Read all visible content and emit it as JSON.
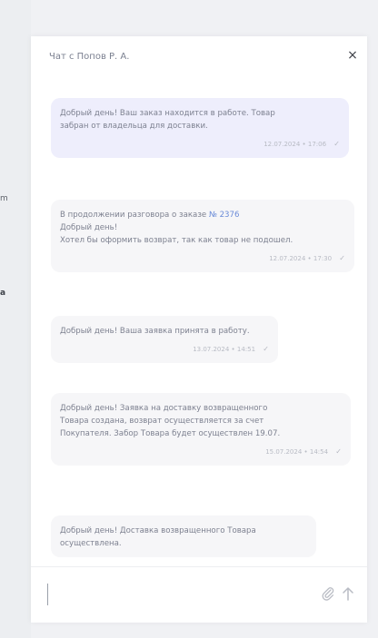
{
  "background": {
    "fragments": [
      "m",
      "а"
    ]
  },
  "chat": {
    "title": "Чат с Попов Р. А.",
    "close_label": "×",
    "input_placeholder": "",
    "messages": [
      {
        "direction": "outgoing",
        "lines": [
          "Добрый день! Ваш заказ находится в работе. Товар",
          "забран от владельца для доставки."
        ],
        "time": "12.07.2024 • 17:06"
      },
      {
        "direction": "incoming",
        "lines": [
          "В продолжении разговора о заказе ",
          "Добрый день!",
          "Хотел бы оформить возврат, так как товар не подошел."
        ],
        "link": "№ 2376",
        "time": "12.07.2024 • 17:30"
      },
      {
        "direction": "incoming",
        "lines": [
          "Добрый день! Ваша заявка принята в работу."
        ],
        "time": "13.07.2024 • 14:51"
      },
      {
        "direction": "incoming",
        "lines": [
          "Добрый день! Заявка на доставку возвращенного",
          "Товара создана, возврат осуществляется за счет",
          "Покупателя. Забор Товара будет осуществлен 19.07."
        ],
        "time": "15.07.2024 • 14:54"
      },
      {
        "direction": "incoming",
        "lines": [
          "Добрый день! Доставка возвращенного Товара",
          "осуществлена."
        ],
        "time": ""
      }
    ]
  }
}
